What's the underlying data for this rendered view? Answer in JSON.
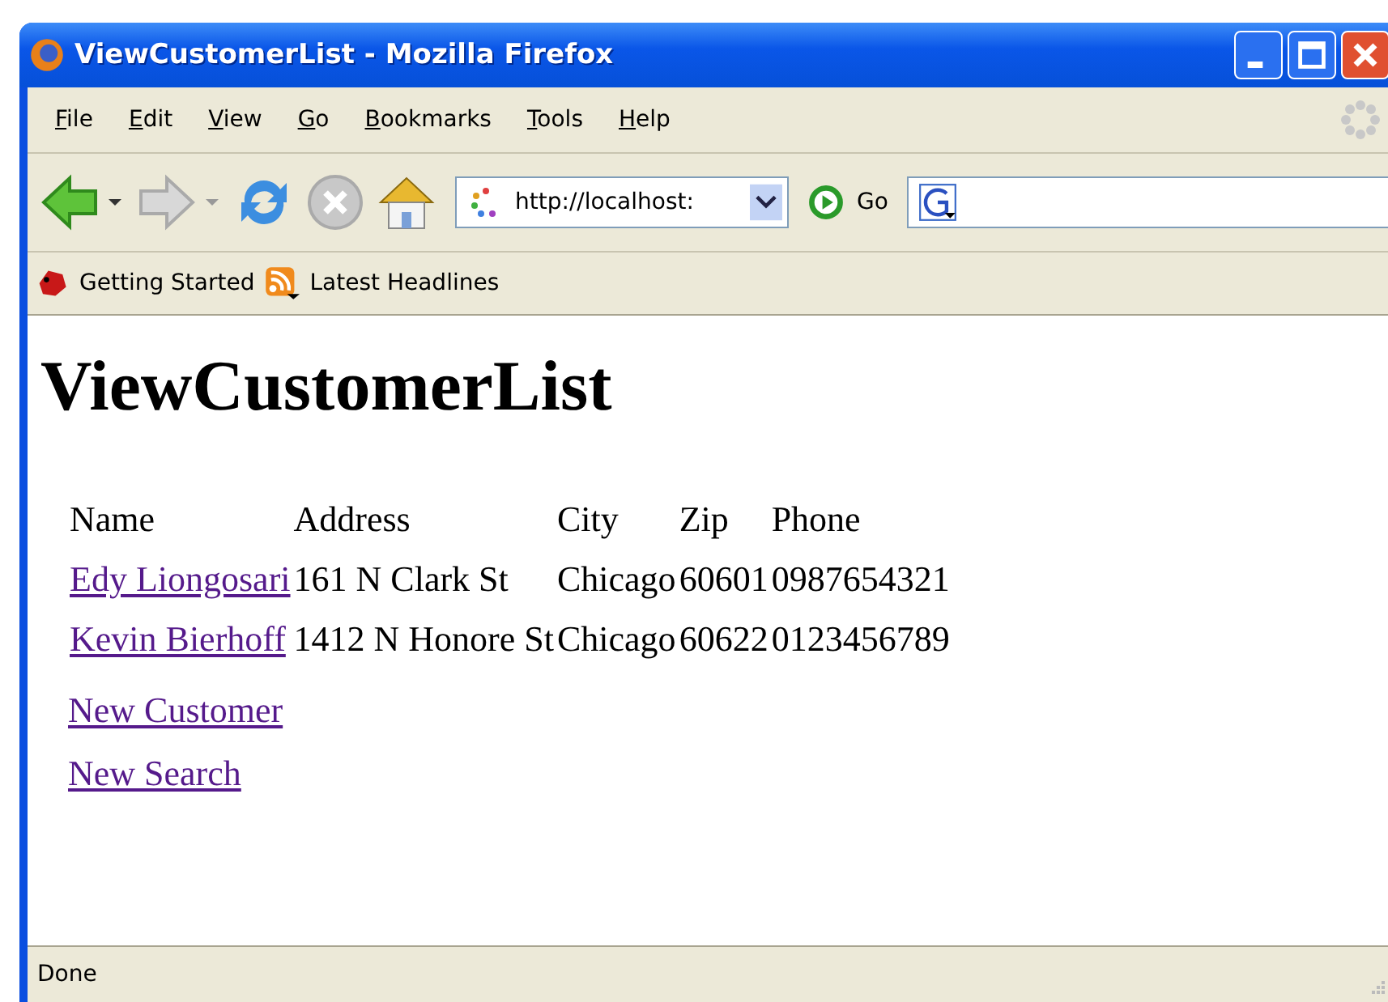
{
  "window": {
    "title": "ViewCustomerList - Mozilla Firefox"
  },
  "menu": [
    "File",
    "Edit",
    "View",
    "Go",
    "Bookmarks",
    "Tools",
    "Help"
  ],
  "toolbar": {
    "address": "http://localhost:",
    "go_label": "Go"
  },
  "bookmarks": [
    {
      "label": "Getting Started",
      "kind": "bug"
    },
    {
      "label": "Latest Headlines",
      "kind": "feed"
    }
  ],
  "page": {
    "heading": "ViewCustomerList",
    "table": {
      "columns": [
        "Name",
        "Address",
        "City",
        "Zip",
        "Phone"
      ],
      "rows": [
        {
          "name": "Edy Liongosari",
          "address": "161 N Clark St",
          "city": "Chicago",
          "zip": "60601",
          "phone": "0987654321"
        },
        {
          "name": "Kevin Bierhoff",
          "address": "1412 N Honore St",
          "city": "Chicago",
          "zip": "60622",
          "phone": "0123456789"
        }
      ]
    },
    "links": [
      "New Customer",
      "New Search"
    ]
  },
  "status_bar": {
    "text": "Done"
  }
}
